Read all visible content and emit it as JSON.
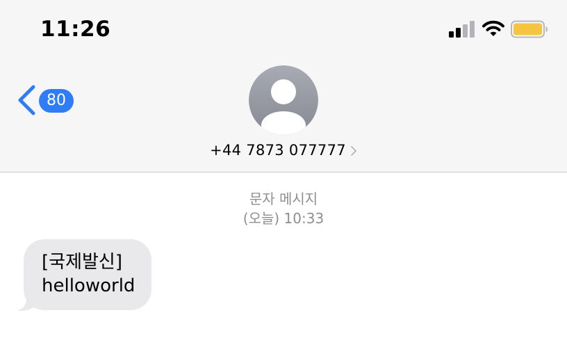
{
  "status_bar": {
    "time": "11:26",
    "signal_icon": "cellular-signal-icon",
    "wifi_icon": "wifi-icon",
    "battery_icon": "battery-icon",
    "battery_color": "#f5c542"
  },
  "nav": {
    "back_icon": "chevron-left-icon",
    "unread_count": "80",
    "accent_color": "#2e7cf6"
  },
  "contact": {
    "avatar_icon": "person-avatar-icon",
    "name": "+44 7873 077777",
    "chevron_icon": "chevron-right-icon"
  },
  "thread": {
    "service_label": "문자 메시지",
    "timestamp": "(오늘) 10:33",
    "messages": [
      {
        "direction": "incoming",
        "lines": [
          "[국제발신]",
          "helloworld"
        ]
      }
    ]
  }
}
